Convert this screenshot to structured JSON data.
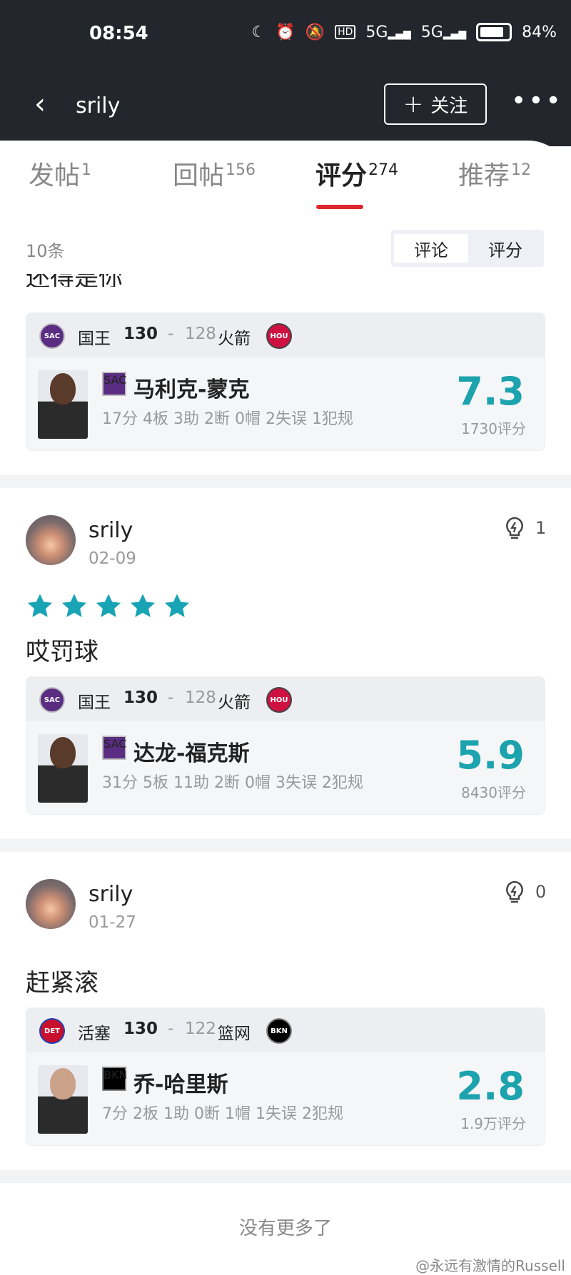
{
  "status": {
    "time": "08:54",
    "battery": "84%",
    "signal1": "5G",
    "signal2": "5G",
    "hd": "HD"
  },
  "header": {
    "title": "srily",
    "follow_label": "关注"
  },
  "tabs": [
    {
      "label": "发帖",
      "count": "1"
    },
    {
      "label": "回帖",
      "count": "156"
    },
    {
      "label": "评分",
      "count": "274"
    },
    {
      "label": "推荐",
      "count": "12"
    }
  ],
  "list": {
    "count_label": "10条",
    "toggle": [
      "评论",
      "评分"
    ],
    "clipped_text": "还得是你"
  },
  "cards": [
    {
      "home": "国王",
      "home_logo": "SAC",
      "home_score": "130",
      "away_score": "128",
      "away": "火箭",
      "away_logo": "HOU",
      "player": "马利克-蒙克",
      "player_logo": "SAC",
      "stats": "17分 4板 3助 2断 0帽 2失误 1犯规",
      "rating": "7.3",
      "votes": "1730评分"
    },
    {
      "home": "国王",
      "home_logo": "SAC",
      "home_score": "130",
      "away_score": "128",
      "away": "火箭",
      "away_logo": "HOU",
      "player": "达龙-福克斯",
      "player_logo": "SAC",
      "stats": "31分 5板 11助 2断 0帽 3失误 2犯规",
      "rating": "5.9",
      "votes": "8430评分"
    },
    {
      "home": "活塞",
      "home_logo": "DET",
      "home_score": "130",
      "away_score": "122",
      "away": "篮网",
      "away_logo": "BKN",
      "player": "乔-哈里斯",
      "player_logo": "BKN",
      "stats": "7分 2板 1助 0断 1帽 1失误 2犯规",
      "rating": "2.8",
      "votes": "1.9万评分"
    }
  ],
  "posts": [
    {
      "user": "srily",
      "date": "02-09",
      "likes": "1",
      "stars": 5,
      "text": "哎罚球"
    },
    {
      "user": "srily",
      "date": "01-27",
      "likes": "0",
      "stars": 0,
      "text": "赶紧滚"
    }
  ],
  "footer": {
    "no_more": "没有更多了",
    "watermark": "@永远有激情的Russell"
  },
  "colors": {
    "accent": "#e0262f",
    "rating": "#1ca3ad",
    "star": "#18a4b4"
  }
}
